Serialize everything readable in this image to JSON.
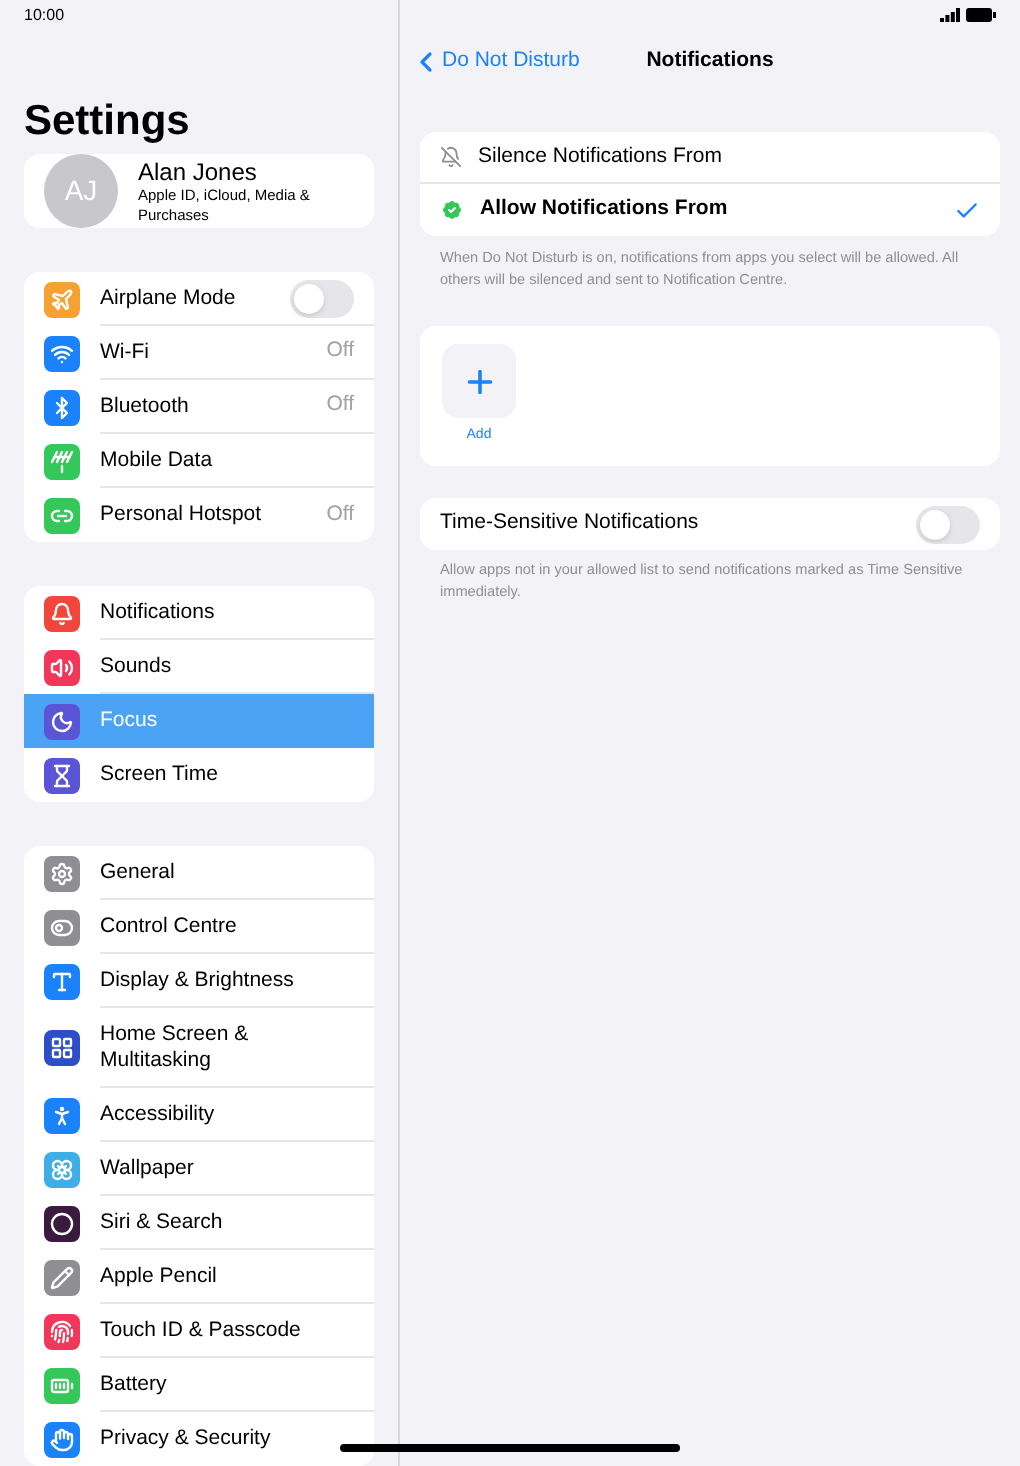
{
  "status_bar": {
    "time": "10:00"
  },
  "sidebar": {
    "title": "Settings",
    "profile": {
      "initials": "AJ",
      "name": "Alan Jones",
      "subtitle": "Apple ID, iCloud, Media & Purchases"
    },
    "groups": [
      {
        "items": [
          {
            "kind": "airplane",
            "label": "Airplane Mode",
            "color": "#f7a133",
            "selected": false,
            "toggle": {
              "on": false
            }
          },
          {
            "kind": "wifi",
            "label": "Wi-Fi",
            "color": "#1a82fb",
            "selected": false,
            "value": "Off"
          },
          {
            "kind": "bluetooth",
            "label": "Bluetooth",
            "color": "#1a82fb",
            "selected": false,
            "value": "Off"
          },
          {
            "kind": "antenna",
            "label": "Mobile Data",
            "color": "#34c759",
            "selected": false
          },
          {
            "kind": "hotspot",
            "label": "Personal Hotspot",
            "color": "#34c759",
            "selected": false,
            "value": "Off"
          }
        ]
      },
      {
        "items": [
          {
            "kind": "bell",
            "label": "Notifications",
            "color": "#f2463c",
            "selected": false
          },
          {
            "kind": "speaker",
            "label": "Sounds",
            "color": "#f2375a",
            "selected": false
          },
          {
            "kind": "moon",
            "label": "Focus",
            "color": "#5a55d6",
            "selected": true
          },
          {
            "kind": "hourglass",
            "label": "Screen Time",
            "color": "#5a55d6",
            "selected": false
          }
        ]
      },
      {
        "items": [
          {
            "kind": "gear",
            "label": "General",
            "color": "#8e8e93",
            "selected": false
          },
          {
            "kind": "switches",
            "label": "Control Centre",
            "color": "#8e8e93",
            "selected": false
          },
          {
            "kind": "text",
            "label": "Display & Brightness",
            "color": "#1a82fb",
            "selected": false
          },
          {
            "kind": "grid",
            "label": "Home Screen & Multitasking",
            "color": "#2c4ec9",
            "selected": false
          },
          {
            "kind": "person",
            "label": "Accessibility",
            "color": "#1a82fb",
            "selected": false
          },
          {
            "kind": "flower",
            "label": "Wallpaper",
            "color": "#3daee6",
            "selected": false
          },
          {
            "kind": "orb",
            "label": "Siri & Search",
            "color": "#3b1a3f",
            "selected": false
          },
          {
            "kind": "pencil",
            "label": "Apple Pencil",
            "color": "#8e8e93",
            "selected": false
          },
          {
            "kind": "fingerprint",
            "label": "Touch ID & Passcode",
            "color": "#f2375a",
            "selected": false
          },
          {
            "kind": "battery",
            "label": "Battery",
            "color": "#34c759",
            "selected": false
          },
          {
            "kind": "hand",
            "label": "Privacy & Security",
            "color": "#1a82fb",
            "selected": false
          }
        ]
      }
    ]
  },
  "detail": {
    "back": "Do Not Disturb",
    "title": "Notifications",
    "options": [
      {
        "kind": "silence",
        "label": "Silence Notifications From",
        "selected": false
      },
      {
        "kind": "allow",
        "label": "Allow Notifications From",
        "selected": true
      }
    ],
    "options_footer": "When Do Not Disturb is on, notifications from apps you select will be allowed. All others will be silenced and sent to Notification Centre.",
    "add_label": "Add",
    "time_sensitive": {
      "label": "Time-Sensitive Notifications",
      "on": false
    },
    "time_sensitive_footer": "Allow apps not in your allowed list to send notifications marked as Time Sensitive immediately."
  }
}
